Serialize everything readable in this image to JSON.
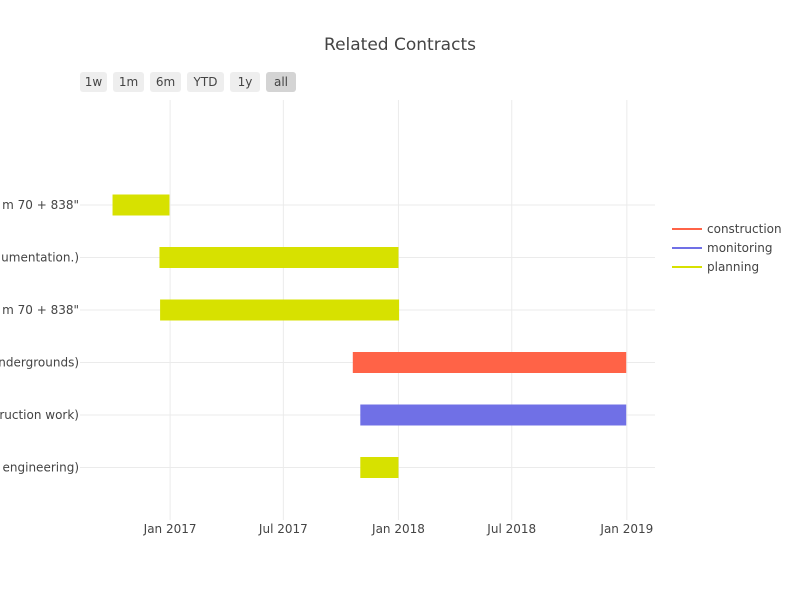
{
  "chart_data": {
    "type": "gantt",
    "title": "Related Contracts",
    "range_selector": {
      "buttons": [
        "1w",
        "1m",
        "6m",
        "YTD",
        "1y",
        "all"
      ],
      "active": "all"
    },
    "x_axis": {
      "type": "date",
      "range": [
        "2016-08-10",
        "2019-02-15"
      ],
      "ticks": [
        {
          "date": "2017-01-01",
          "label": "Jan 2017"
        },
        {
          "date": "2017-07-01",
          "label": "Jul 2017"
        },
        {
          "date": "2018-01-01",
          "label": "Jan 2018"
        },
        {
          "date": "2018-07-01",
          "label": "Jul 2018"
        },
        {
          "date": "2019-01-01",
          "label": "Jan 2019"
        }
      ]
    },
    "y_labels": [
      "m 70 + 838\"",
      "umentation.)",
      "m 70 + 838\"",
      "ndergrounds)",
      "ruction work)",
      " engineering)"
    ],
    "tasks": [
      {
        "row": 0,
        "category": "planning",
        "start": "2016-10-01",
        "end": "2016-12-31"
      },
      {
        "row": 1,
        "category": "planning",
        "start": "2016-12-15",
        "end": "2018-01-01"
      },
      {
        "row": 2,
        "category": "planning",
        "start": "2016-12-16",
        "end": "2018-01-02"
      },
      {
        "row": 3,
        "category": "construction",
        "start": "2017-10-20",
        "end": "2018-12-31"
      },
      {
        "row": 4,
        "category": "monitoring",
        "start": "2017-11-01",
        "end": "2018-12-31"
      },
      {
        "row": 5,
        "category": "planning",
        "start": "2017-11-01",
        "end": "2018-01-01"
      }
    ],
    "legend": {
      "position": "right",
      "items": [
        {
          "name": "construction",
          "color": "#ff6347"
        },
        {
          "name": "monitoring",
          "color": "#7070e6"
        },
        {
          "name": "planning",
          "color": "#d7e100"
        }
      ]
    },
    "colors": {
      "construction": "#ff6347",
      "monitoring": "#7070e6",
      "planning": "#d7e100"
    },
    "grid": true
  }
}
